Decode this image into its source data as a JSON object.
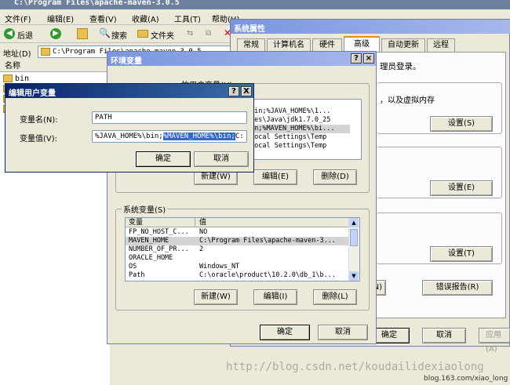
{
  "explorer": {
    "title": "C:\\Program Files\\apache-maven-3.0.5",
    "menu": [
      "文件(F)",
      "编辑(E)",
      "查看(V)",
      "收藏(A)",
      "工具(T)",
      "帮助(H)"
    ],
    "back_label": "后退",
    "search_label": "搜索",
    "folders_label": "文件夹",
    "address_label": "地址(D)",
    "address_value": "C:\\Program Files\\apache-maven-3.0.5",
    "column_name": "名称",
    "items": [
      "bin",
      "",
      "",
      "",
      ""
    ]
  },
  "sysprops": {
    "title": "系统属性",
    "tabs": [
      "常规",
      "计算机名",
      "硬件",
      "高级",
      "自动更新",
      "远程"
    ],
    "admin_text": "理员登录。",
    "perf_text": "，以及虚拟内存",
    "settings_label": "设置(S)",
    "settings2_label": "设置(E)",
    "settings3_label": "设置(T)",
    "env_partial": "N)",
    "error_report_label": "错误报告(R)",
    "ok_label": "确定",
    "cancel_label": "取消",
    "apply_label": "应用(A)"
  },
  "envvars": {
    "title": "环境变量",
    "user_group": "的用户变量(U)",
    "user_rows": [
      "bin;%JAVA_HOME%\\1...",
      "les\\Java\\jdk1.7.0_25",
      "in;%MAVEN_HOME%\\bi...",
      "Local Settings\\Temp",
      "Local Settings\\Temp"
    ],
    "new_label": "新建(W)",
    "edit_label": "编辑(E)",
    "delete_label": "删除(D)",
    "sys_group": "系统变量(S)",
    "col_var": "变量",
    "col_val": "值",
    "sys_rows": [
      {
        "var": "FP_NO_HOST_C...",
        "val": "NO"
      },
      {
        "var": "MAVEN_HOME",
        "val": "C:\\Program Files\\apache-maven-3..."
      },
      {
        "var": "NUMBER_OF_PR...",
        "val": "2"
      },
      {
        "var": "ORACLE_HOME",
        "val": ""
      },
      {
        "var": "OS",
        "val": "Windows_NT"
      },
      {
        "var": "Path",
        "val": "C:\\oracle\\product\\10.2.0\\db_1\\b..."
      }
    ],
    "sys_new_label": "新建(W)",
    "sys_edit_label": "编辑(I)",
    "sys_delete_label": "删除(L)",
    "ok_label": "确定",
    "cancel_label": "取消"
  },
  "edit_dialog": {
    "title": "编辑用户变量",
    "name_label": "变量名(N):",
    "name_value": "PATH",
    "value_label": "变量值(V):",
    "value_prefix": "%JAVA_HOME%\\bin;",
    "value_selected": "%MAVEN_HOME%\\bin;",
    "value_suffix": "C:",
    "ok_label": "确定",
    "cancel_label": "取消",
    "help_btn": "?",
    "close_btn": "X"
  },
  "watermark": {
    "url": "http://blog.csdn.net/koudailidexiaolong",
    "site": "blog.163.com/xiao_long"
  },
  "colors": {
    "title_active": "#0a246a",
    "selection": "#316ac5",
    "face": "#ece9d8"
  }
}
